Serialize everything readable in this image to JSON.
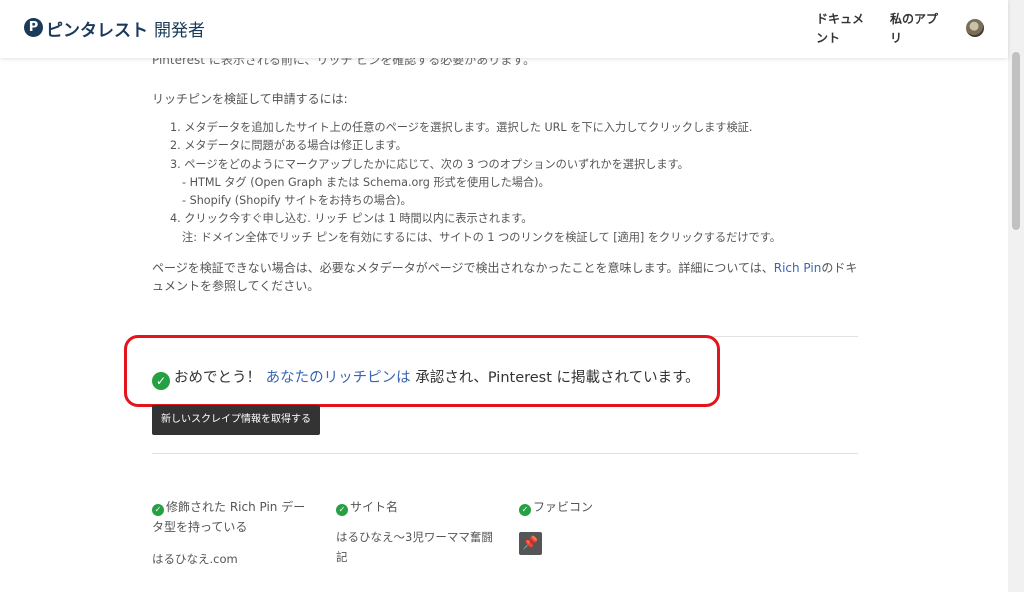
{
  "header": {
    "logo_glyph": "P",
    "brand": "ピンタレスト",
    "brand_sub": "開発者",
    "nav": [
      "ドキュメント",
      "私のアプリ"
    ]
  },
  "intro_cut": "Pinterest に表示される前に、リッチ ピンを確認する必要があります。",
  "apply_heading": "リッチピンを検証して申請するには:",
  "steps": [
    "1. メタデータを追加したサイト上の任意のページを選択します。選択した URL を下に入力してクリックします検証.",
    "2. メタデータに問題がある場合は修正します。",
    "3. ページをどのようにマークアップしたかに応じて、次の 3 つのオプションのいずれかを選択します。",
    "- HTML タグ (Open Graph または Schema.org 形式を使用した場合)。",
    "- Shopify (Shopify サイトをお持ちの場合)。",
    "4. クリック今すぐ申し込む. リッチ ピンは 1 時間以内に表示されます。",
    "注: ドメイン全体でリッチ ピンを有効にするには、サイトの 1 つのリンクを検証して [適用] をクリックするだけです。"
  ],
  "not_verified": {
    "before": "ページを検証できない場合は、必要なメタデータがページで検出されなかったことを意味します。詳細については、",
    "link": "Rich Pin",
    "after": "のドキュメントを参照してください。"
  },
  "success": {
    "check": "✓",
    "congrats": "おめでとう！",
    "link": "あなたのリッチピンは",
    "rest": "承認され、Pinterest に掲載されています。"
  },
  "scrape_button": "新しいスクレイプ情報を取得する",
  "details": [
    {
      "label": "修飾された Rich Pin データ型を持っている",
      "value": "はるひなえ.com"
    },
    {
      "label": "サイト名",
      "value": "はるひなえ～3児ワーママ奮闘記"
    },
    {
      "label": "ファビコン",
      "value": ""
    }
  ],
  "favicon_glyph": "📌",
  "colors": {
    "accent": "#3b66b4",
    "success": "#26a042",
    "highlight": "#e3141c",
    "button": "#333333"
  }
}
